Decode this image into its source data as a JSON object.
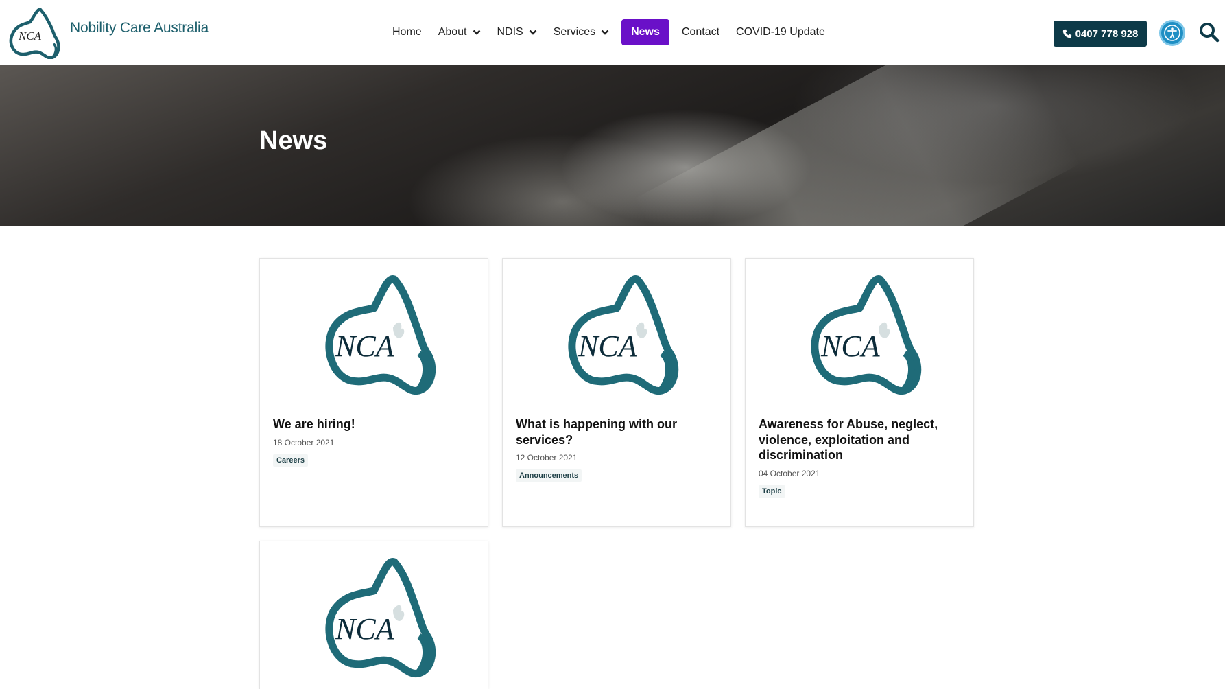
{
  "brand": {
    "name": "Nobility Care Australia",
    "logo_text": "NCA"
  },
  "nav": {
    "items": [
      {
        "label": "Home",
        "has_dropdown": false,
        "active": false
      },
      {
        "label": "About",
        "has_dropdown": true,
        "active": false
      },
      {
        "label": "NDIS",
        "has_dropdown": true,
        "active": false
      },
      {
        "label": "Services",
        "has_dropdown": true,
        "active": false
      },
      {
        "label": "News",
        "has_dropdown": false,
        "active": true
      },
      {
        "label": "Contact",
        "has_dropdown": false,
        "active": false
      },
      {
        "label": "COVID-19 Update",
        "has_dropdown": false,
        "active": false
      }
    ],
    "active_color": "#6a10c8"
  },
  "header": {
    "phone_label": "0407 778 928",
    "phone_icon": "phone-icon",
    "accessibility_icon": "accessibility-icon",
    "search_icon": "search-icon"
  },
  "hero": {
    "title": "News"
  },
  "posts": [
    {
      "title": "We are hiring!",
      "date": "18 October 2021",
      "category": "Careers"
    },
    {
      "title": "What is happening with our services?",
      "date": "12 October 2021",
      "category": "Announcements"
    },
    {
      "title": "Awareness for Abuse, neglect, violence, exploitation and discrimination",
      "date": "04 October 2021",
      "category": "Topic"
    },
    {
      "title": "",
      "date": "",
      "category": ""
    }
  ],
  "colors": {
    "brand_teal": "#1d5f6c",
    "phone_button": "#0d3a48",
    "accessibility": "#1f8fc4"
  }
}
